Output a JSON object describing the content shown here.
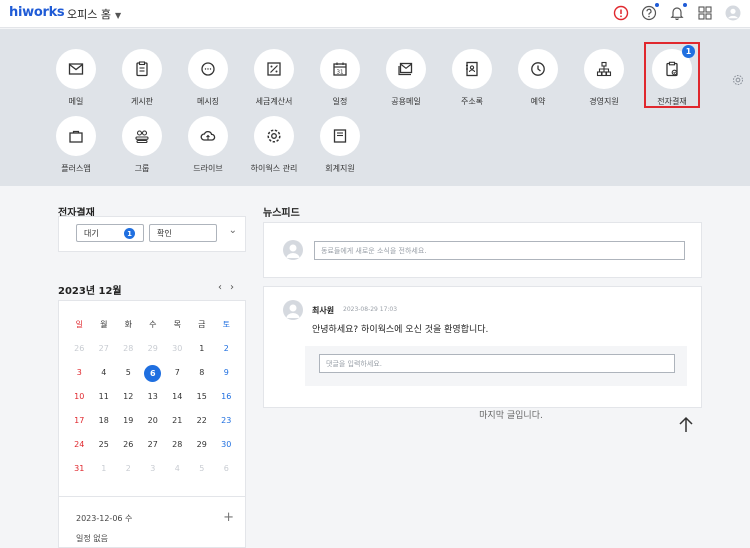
{
  "topbar": {
    "logo": "hiworks",
    "office_home": "오피스 홈",
    "icons": [
      "alert-icon",
      "help-icon",
      "bell-icon",
      "grid-icon",
      "user-icon"
    ]
  },
  "apps": [
    {
      "label": "메일",
      "icon": "mail-icon"
    },
    {
      "label": "게시판",
      "icon": "board-icon"
    },
    {
      "label": "메시징",
      "icon": "chat-icon"
    },
    {
      "label": "세금계산서",
      "icon": "tax-icon"
    },
    {
      "label": "일정",
      "icon": "calendar-icon",
      "text": "31"
    },
    {
      "label": "공용메일",
      "icon": "shared-mail-icon"
    },
    {
      "label": "주소록",
      "icon": "address-book-icon"
    },
    {
      "label": "예약",
      "icon": "clock-icon"
    },
    {
      "label": "경영지원",
      "icon": "org-chart-icon"
    },
    {
      "label": "전자결재",
      "icon": "approval-icon",
      "badge": "1"
    },
    {
      "label": "플러스앱",
      "icon": "bag-icon"
    },
    {
      "label": "그룹",
      "icon": "group-icon"
    },
    {
      "label": "드라이브",
      "icon": "cloud-icon"
    },
    {
      "label": "하이웍스 관리",
      "icon": "gear-icon"
    },
    {
      "label": "회계지원",
      "icon": "accounting-icon"
    }
  ],
  "approval": {
    "title": "전자결재",
    "pending_label": "대기",
    "pending_count": "1",
    "confirm_label": "확인"
  },
  "calendar": {
    "title": "2023년 12월",
    "weekdays": [
      "일",
      "월",
      "화",
      "수",
      "목",
      "금",
      "토"
    ],
    "weeks": [
      [
        "26",
        "27",
        "28",
        "29",
        "30",
        "1",
        "2"
      ],
      [
        "3",
        "4",
        "5",
        "6",
        "7",
        "8",
        "9"
      ],
      [
        "10",
        "11",
        "12",
        "13",
        "14",
        "15",
        "16"
      ],
      [
        "17",
        "18",
        "19",
        "20",
        "21",
        "22",
        "23"
      ],
      [
        "24",
        "25",
        "26",
        "27",
        "28",
        "29",
        "30"
      ],
      [
        "31",
        "1",
        "2",
        "3",
        "4",
        "5",
        "6"
      ]
    ],
    "today": "6",
    "selected_date": "2023-12-06 수",
    "no_schedule": "일정 없음"
  },
  "newsfeed": {
    "title": "뉴스피드",
    "post_placeholder": "동료들에게 새로운 소식을 전하세요.",
    "post": {
      "author": "최사원",
      "date": "2023-08-29 17:03",
      "text": "안녕하세요? 하이웍스에 오신 것을 환영합니다.",
      "comment_placeholder": "댓글을 입력하세요."
    },
    "end_message": "마지막 글입니다."
  },
  "colors": {
    "accent": "#1f6fe0",
    "highlight": "#e0282e",
    "logo": "#1f5bd6"
  }
}
